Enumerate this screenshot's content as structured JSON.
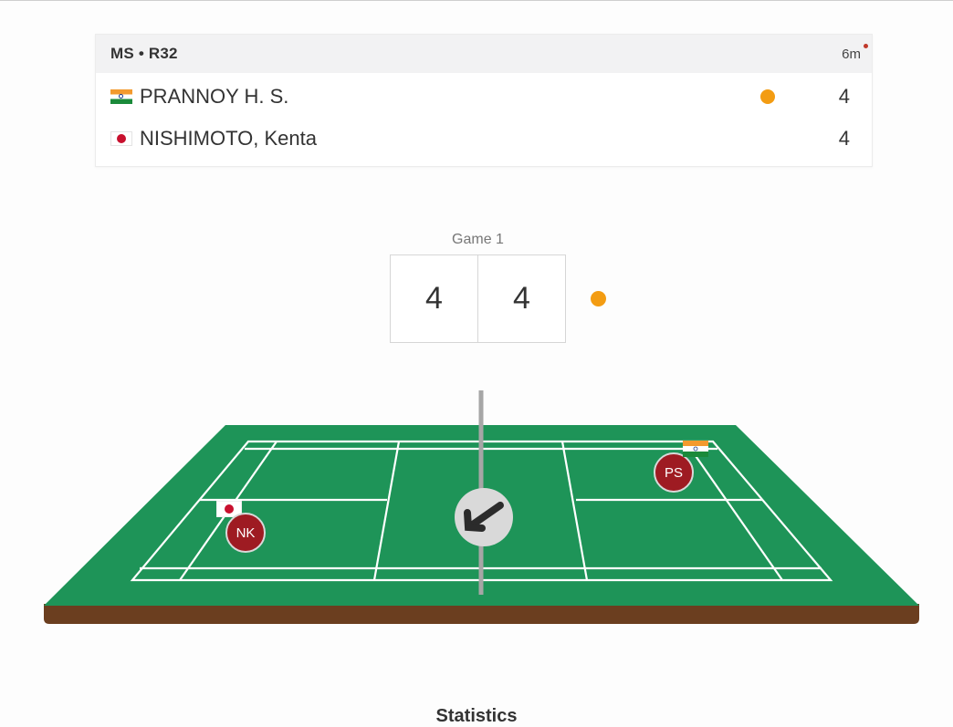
{
  "match": {
    "round": "MS • R32",
    "elapsed": "6m",
    "players": [
      {
        "name": "PRANNOY H. S.",
        "country": "India",
        "score": "4",
        "serving": true
      },
      {
        "name": "NISHIMOTO, Kenta",
        "country": "Japan",
        "score": "4",
        "serving": false
      }
    ]
  },
  "game": {
    "label": "Game 1",
    "score_left": "4",
    "score_right": "4"
  },
  "court": {
    "tokens": {
      "left": "NK",
      "right": "PS"
    },
    "colors": {
      "surface": "#1e9458",
      "lines": "#ffffff",
      "base": "#6b3e1f",
      "token": "#9e1b22",
      "serve": "#f39c12"
    },
    "shuttle_icon": "arrow-down-left-icon"
  },
  "statistics": {
    "title": "Statistics"
  }
}
